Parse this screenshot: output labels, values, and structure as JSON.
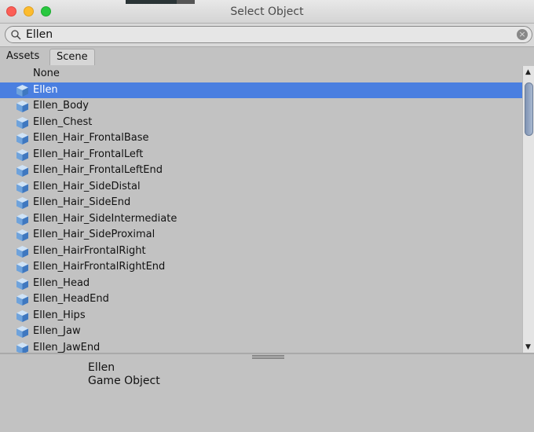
{
  "window": {
    "title": "Select Object"
  },
  "search": {
    "value": "Ellen"
  },
  "tabs": [
    {
      "label": "Assets"
    },
    {
      "label": "Scene"
    }
  ],
  "list": {
    "none_label": "None",
    "items": [
      "Ellen",
      "Ellen_Body",
      "Ellen_Chest",
      "Ellen_Hair_FrontalBase",
      "Ellen_Hair_FrontalLeft",
      "Ellen_Hair_FrontalLeftEnd",
      "Ellen_Hair_SideDistal",
      "Ellen_Hair_SideEnd",
      "Ellen_Hair_SideIntermediate",
      "Ellen_Hair_SideProximal",
      "Ellen_HairFrontalRight",
      "Ellen_HairFrontalRightEnd",
      "Ellen_Head",
      "Ellen_HeadEnd",
      "Ellen_Hips",
      "Ellen_Jaw",
      "Ellen_JawEnd"
    ],
    "selected_index": 0
  },
  "info": {
    "name": "Ellen",
    "type": "Game Object"
  },
  "colors": {
    "selection": "#4a7fe0",
    "background": "#c2c2c2"
  }
}
